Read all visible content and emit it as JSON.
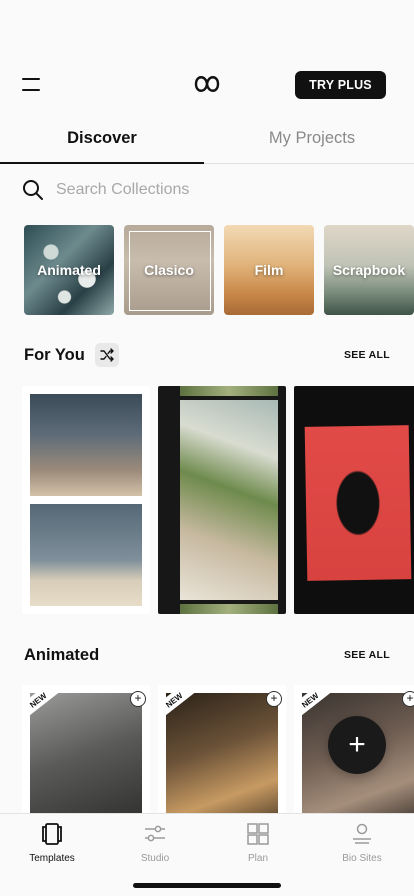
{
  "header": {
    "try_plus": "TRY PLUS",
    "menu_icon": "hamburger-icon",
    "logo_icon": "unfold-logo-icon"
  },
  "tabs": [
    {
      "label": "Discover",
      "active": true
    },
    {
      "label": "My Projects",
      "active": false
    }
  ],
  "search": {
    "placeholder": "Search Collections",
    "value": ""
  },
  "collections": [
    {
      "label": "Animated"
    },
    {
      "label": "Clasico"
    },
    {
      "label": "Film"
    },
    {
      "label": "Scrapbook"
    }
  ],
  "for_you": {
    "title": "For You",
    "see_all": "SEE ALL"
  },
  "animated": {
    "title": "Animated",
    "see_all": "SEE ALL",
    "badge": "NEW",
    "add": "+"
  },
  "fab": {
    "label": "+"
  },
  "tabbar": [
    {
      "label": "Templates",
      "icon": "templates-icon",
      "active": true
    },
    {
      "label": "Studio",
      "icon": "sliders-icon",
      "active": false
    },
    {
      "label": "Plan",
      "icon": "grid-icon",
      "active": false
    },
    {
      "label": "Bio Sites",
      "icon": "person-icon",
      "active": false
    }
  ],
  "colors": {
    "accent": "#111111",
    "muted": "#9a9a9a",
    "background": "#fafafa"
  }
}
